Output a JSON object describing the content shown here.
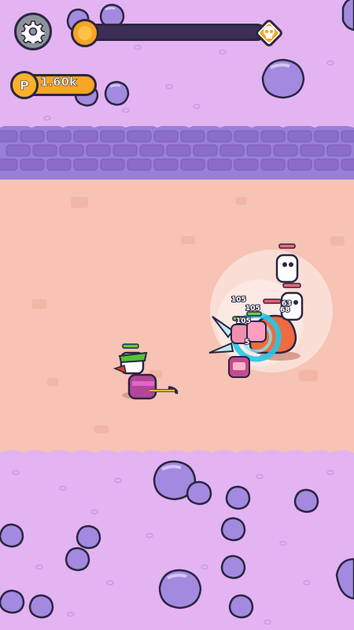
{
  "hud": {
    "settings_icon": "gear-icon",
    "boss_icon": "skull-icon",
    "level_progress": 0.05,
    "coins": {
      "icon_letter": "P",
      "value": "1.60k"
    }
  },
  "combat": {
    "damage_numbers": [
      "105",
      "105",
      "105",
      "63",
      "68",
      "5"
    ]
  },
  "colors": {
    "ground": "#f6c3b4",
    "stone": "#e3b3f2",
    "wall": "#9a7fd6",
    "rock": "#a38ae0",
    "coin": "#f8a424",
    "outline": "#2b2640"
  }
}
